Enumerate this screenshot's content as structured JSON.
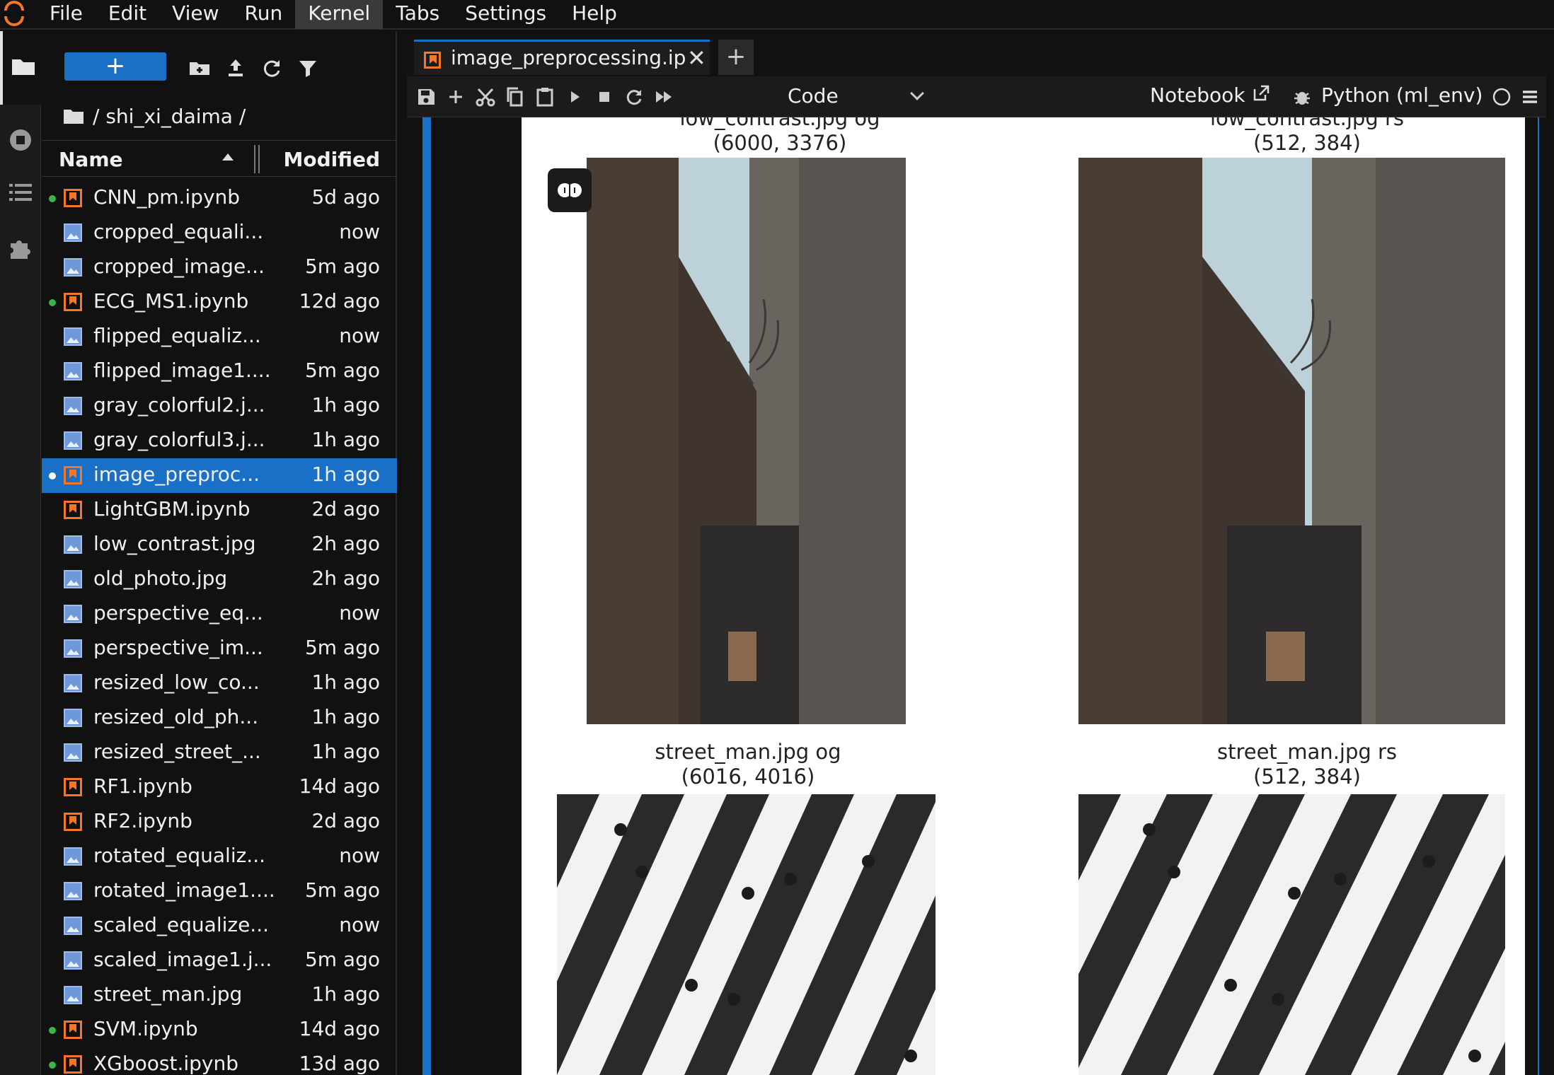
{
  "menubar": {
    "items": [
      "File",
      "Edit",
      "View",
      "Run",
      "Kernel",
      "Tabs",
      "Settings",
      "Help"
    ],
    "active": "Kernel"
  },
  "activity_icons": [
    "folder-icon",
    "running-icon",
    "toc-icon",
    "extension-icon"
  ],
  "filebrowser": {
    "new_label": "+",
    "breadcrumb": "/ shi_xi_daima /",
    "columns": {
      "name": "Name",
      "modified": "Modified"
    },
    "files": [
      {
        "name": "CNN_pm.ipynb",
        "modified": "5d ago",
        "type": "notebook",
        "running": true
      },
      {
        "name": "cropped_equali...",
        "modified": "now",
        "type": "image",
        "running": false
      },
      {
        "name": "cropped_image...",
        "modified": "5m ago",
        "type": "image",
        "running": false
      },
      {
        "name": "ECG_MS1.ipynb",
        "modified": "12d ago",
        "type": "notebook",
        "running": true
      },
      {
        "name": "flipped_equaliz...",
        "modified": "now",
        "type": "image",
        "running": false
      },
      {
        "name": "flipped_image1....",
        "modified": "5m ago",
        "type": "image",
        "running": false
      },
      {
        "name": "gray_colorful2.j...",
        "modified": "1h ago",
        "type": "image",
        "running": false
      },
      {
        "name": "gray_colorful3.j...",
        "modified": "1h ago",
        "type": "image",
        "running": false
      },
      {
        "name": "image_preproc...",
        "modified": "1h ago",
        "type": "notebook",
        "running": true,
        "selected": true
      },
      {
        "name": "LightGBM.ipynb",
        "modified": "2d ago",
        "type": "notebook",
        "running": false
      },
      {
        "name": "low_contrast.jpg",
        "modified": "2h ago",
        "type": "image",
        "running": false
      },
      {
        "name": "old_photo.jpg",
        "modified": "2h ago",
        "type": "image",
        "running": false
      },
      {
        "name": "perspective_eq...",
        "modified": "now",
        "type": "image",
        "running": false
      },
      {
        "name": "perspective_im...",
        "modified": "5m ago",
        "type": "image",
        "running": false
      },
      {
        "name": "resized_low_co...",
        "modified": "1h ago",
        "type": "image",
        "running": false
      },
      {
        "name": "resized_old_ph...",
        "modified": "1h ago",
        "type": "image",
        "running": false
      },
      {
        "name": "resized_street_...",
        "modified": "1h ago",
        "type": "image",
        "running": false
      },
      {
        "name": "RF1.ipynb",
        "modified": "14d ago",
        "type": "notebook",
        "running": false
      },
      {
        "name": "RF2.ipynb",
        "modified": "2d ago",
        "type": "notebook",
        "running": false
      },
      {
        "name": "rotated_equaliz...",
        "modified": "now",
        "type": "image",
        "running": false
      },
      {
        "name": "rotated_image1....",
        "modified": "5m ago",
        "type": "image",
        "running": false
      },
      {
        "name": "scaled_equalize...",
        "modified": "now",
        "type": "image",
        "running": false
      },
      {
        "name": "scaled_image1.j...",
        "modified": "5m ago",
        "type": "image",
        "running": false
      },
      {
        "name": "street_man.jpg",
        "modified": "1h ago",
        "type": "image",
        "running": false
      },
      {
        "name": "SVM.ipynb",
        "modified": "14d ago",
        "type": "notebook",
        "running": true
      },
      {
        "name": "XGboost.ipynb",
        "modified": "13d ago",
        "type": "notebook",
        "running": true
      }
    ]
  },
  "tab": {
    "label": "image_preprocessing.ipynb",
    "close": "✕",
    "add": "+"
  },
  "toolbar": {
    "cell_type": "Code",
    "notebook_label": "Notebook",
    "kernel": "Python (ml_env)"
  },
  "output": {
    "plots": [
      {
        "title": "low_contrast.jpg og",
        "size": "(6000, 3376)",
        "scene": "building"
      },
      {
        "title": "low_contrast.jpg rs",
        "size": "(512, 384)",
        "scene": "building"
      },
      {
        "title": "street_man.jpg og",
        "size": "(6016, 4016)",
        "scene": "crosswalk"
      },
      {
        "title": "street_man.jpg rs",
        "size": "(512, 384)",
        "scene": "crosswalk"
      }
    ]
  },
  "colors": {
    "accent": "#1a6fc7",
    "notebook_icon": "#f37726",
    "running_dot": "#3bb54a"
  }
}
